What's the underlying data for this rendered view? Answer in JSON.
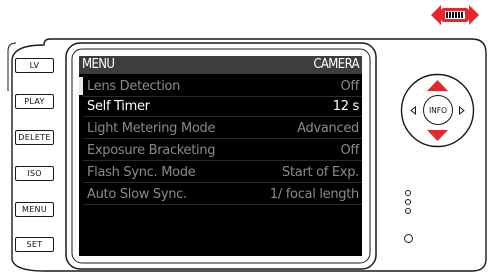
{
  "side_buttons": [
    {
      "label": "LV"
    },
    {
      "label": "PLAY"
    },
    {
      "label": "DELETE"
    },
    {
      "label": "ISO"
    },
    {
      "label": "MENU"
    },
    {
      "label": "SET"
    }
  ],
  "screen": {
    "header_title": "MENU",
    "header_section": "CAMERA",
    "items": [
      {
        "label": "Lens Detection",
        "value": "Off"
      },
      {
        "label": "Self Timer",
        "value": "12 s"
      },
      {
        "label": "Light Metering Mode",
        "value": "Advanced"
      },
      {
        "label": "Exposure Bracketing",
        "value": "Off"
      },
      {
        "label": "Flash Sync. Mode",
        "value": "Start of Exp."
      },
      {
        "label": "Auto Slow Sync.",
        "value": "1/ focal length"
      }
    ],
    "selected_index": 1
  },
  "dpad": {
    "center_label": "INFO",
    "accent_color": "#e8262d"
  },
  "battery": {
    "color": "#e8262d"
  }
}
